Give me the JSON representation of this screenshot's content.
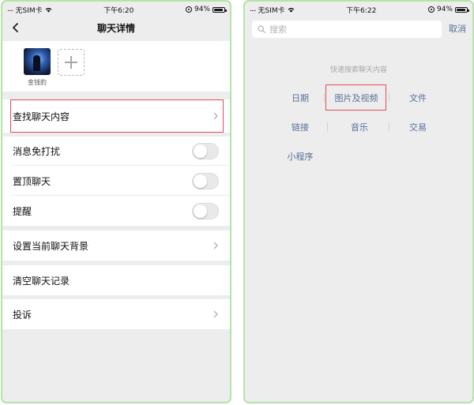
{
  "colors": {
    "frame_border": "#b6e3a6",
    "background": "#ededed",
    "link_blue": "#57709a",
    "highlight_red": "#e04e55"
  },
  "left_screen": {
    "status_bar": {
      "carrier": "无SIM卡",
      "time": "下午6:20",
      "battery": "94%"
    },
    "nav": {
      "back_icon": "chevron-left-icon",
      "title": "聊天详情"
    },
    "members": [
      {
        "name": "金钱豹"
      }
    ],
    "add_member_icon": "plus-icon",
    "cells": [
      {
        "label": "查找聊天内容",
        "type": "link",
        "highlighted": true
      },
      {
        "label": "消息免打扰",
        "type": "toggle",
        "on": false
      },
      {
        "label": "置顶聊天",
        "type": "toggle",
        "on": false
      },
      {
        "label": "提醒",
        "type": "toggle",
        "on": false
      },
      {
        "label": "设置当前聊天背景",
        "type": "link"
      },
      {
        "label": "清空聊天记录",
        "type": "plain"
      },
      {
        "label": "投诉",
        "type": "link"
      }
    ]
  },
  "right_screen": {
    "status_bar": {
      "carrier": "无SIM卡",
      "time": "下午6:22",
      "battery": "94%"
    },
    "search": {
      "placeholder": "搜索",
      "value": "",
      "cancel_label": "取消"
    },
    "quick_search_title": "快速搜索聊天内容",
    "categories": [
      {
        "label": "日期"
      },
      {
        "label": "图片及视频",
        "highlighted": true
      },
      {
        "label": "文件"
      },
      {
        "label": "链接"
      },
      {
        "label": "音乐"
      },
      {
        "label": "交易"
      },
      {
        "label": "小程序"
      }
    ]
  }
}
